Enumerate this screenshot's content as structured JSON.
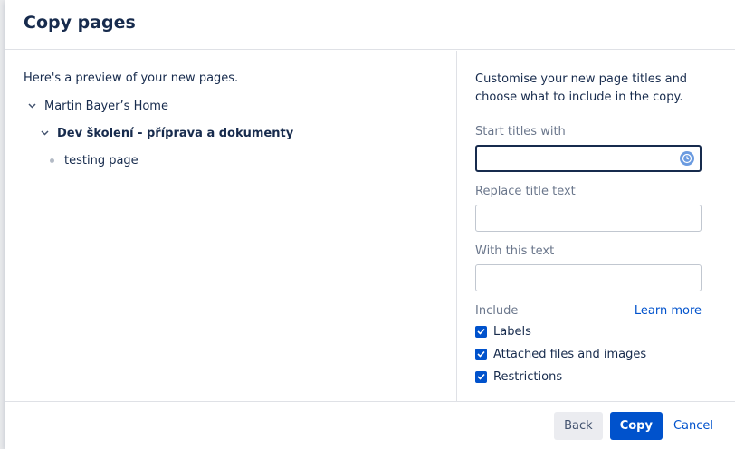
{
  "dialog": {
    "title": "Copy pages"
  },
  "preview": {
    "intro": "Here's a preview of your new pages.",
    "tree": [
      {
        "label": "Martin Bayer’s Home"
      },
      {
        "label": "Dev školení - příprava a dokumenty"
      },
      {
        "label": "testing page"
      }
    ]
  },
  "options": {
    "instructions": "Customise your new page titles and choose what to include in the copy.",
    "start_titles_label": "Start titles with",
    "start_titles_value": "",
    "replace_label": "Replace title text",
    "replace_value": "",
    "with_label": "With this text",
    "with_value": "",
    "include_label": "Include",
    "learn_more": "Learn more",
    "checkboxes": [
      {
        "label": "Labels",
        "checked": true
      },
      {
        "label": "Attached files and images",
        "checked": true
      },
      {
        "label": "Restrictions",
        "checked": true
      }
    ]
  },
  "footer": {
    "back": "Back",
    "copy": "Copy",
    "cancel": "Cancel"
  },
  "colors": {
    "primary": "#0052cc",
    "text": "#172b4d",
    "subtle": "#6b778c"
  }
}
